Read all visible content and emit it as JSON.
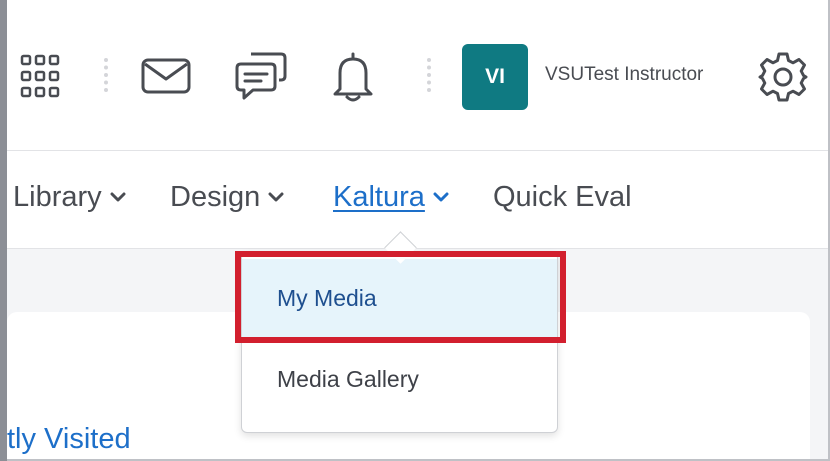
{
  "header": {
    "user": {
      "initials": "VI",
      "name": "VSUTest Instructor"
    },
    "icons": [
      "app-grid-icon",
      "mail-icon",
      "chat-icon",
      "bell-icon",
      "gear-icon"
    ]
  },
  "nav": {
    "items": [
      {
        "label": "Library",
        "has_menu": true
      },
      {
        "label": "Design",
        "has_menu": true
      },
      {
        "label": "Kaltura",
        "has_menu": true,
        "active": true
      },
      {
        "label": "Quick Eval",
        "has_menu": false
      }
    ]
  },
  "dropdown": {
    "items": [
      {
        "label": "My Media",
        "highlighted": true
      },
      {
        "label": "Media Gallery"
      }
    ]
  },
  "content": {
    "widget_title": "tly Visited"
  },
  "colors": {
    "accent": "#1d6fc9",
    "avatar_bg": "#0f7a82",
    "annotation_red": "#d21f2e",
    "highlight_bg": "#e6f4fb"
  }
}
